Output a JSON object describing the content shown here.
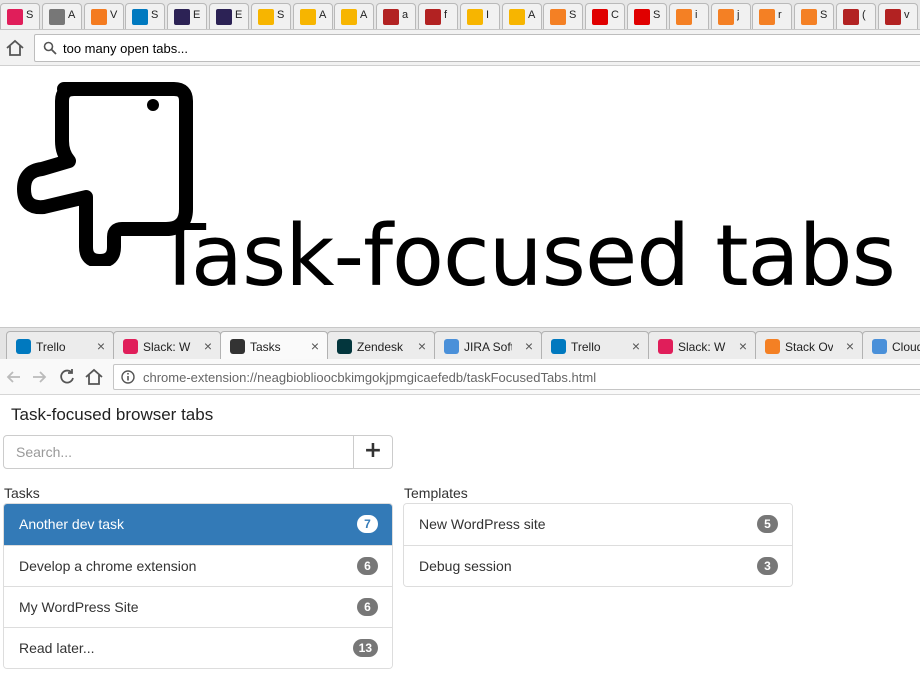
{
  "top_browser": {
    "tab_icons": [
      {
        "icon": "slack-icon",
        "color": "#e01e5a"
      },
      {
        "icon": "apple-icon",
        "color": "#777777"
      },
      {
        "icon": "gear-icon",
        "color": "#f47b20"
      },
      {
        "icon": "trello-icon",
        "color": "#0079bf"
      },
      {
        "icon": "eclipse-icon",
        "color": "#2c2255"
      },
      {
        "icon": "eclipse-icon",
        "color": "#2c2255"
      },
      {
        "icon": "aws-icon",
        "color": "#f7b500"
      },
      {
        "icon": "aws-icon",
        "color": "#f7b500"
      },
      {
        "icon": "aws-icon",
        "color": "#f7b500"
      },
      {
        "icon": "bars-icon",
        "color": "#b22222"
      },
      {
        "icon": "bars-icon",
        "color": "#b22222"
      },
      {
        "icon": "aws-icon",
        "color": "#f7b500"
      },
      {
        "icon": "xml-icon",
        "color": "#f7b500"
      },
      {
        "icon": "stackoverflow-icon",
        "color": "#f48024"
      },
      {
        "icon": "oracle-icon",
        "color": "#e00000"
      },
      {
        "icon": "oracle-icon",
        "color": "#e00000"
      },
      {
        "icon": "stackoverflow-icon",
        "color": "#f48024"
      },
      {
        "icon": "stackoverflow-icon",
        "color": "#f48024"
      },
      {
        "icon": "stackoverflow-icon",
        "color": "#f48024"
      },
      {
        "icon": "stackoverflow-icon",
        "color": "#f48024"
      },
      {
        "icon": "bars-icon",
        "color": "#b22222"
      },
      {
        "icon": "bars-icon",
        "color": "#b22222"
      }
    ],
    "tab_texts": [
      "S",
      "A",
      "V",
      "S",
      "E",
      "E",
      "S",
      "A",
      "A",
      "a",
      "f",
      "I",
      "A",
      "S",
      "C",
      "S",
      "i",
      "j",
      "r",
      "S",
      "(",
      "v"
    ],
    "omnibox_value": "too many open tabs..."
  },
  "hero": {
    "title": "Task-focused tabs"
  },
  "browser": {
    "tabs": [
      {
        "label": "Trello",
        "icon": "trello-icon",
        "color": "#0079bf",
        "active": false
      },
      {
        "label": "Slack: Wi",
        "icon": "slack-icon",
        "color": "#e01e5a",
        "active": false
      },
      {
        "label": "Tasks",
        "icon": "tasks-icon",
        "color": "#333333",
        "active": true
      },
      {
        "label": "Zendesk",
        "icon": "zendesk-icon",
        "color": "#03363d",
        "active": false
      },
      {
        "label": "JIRA Soft",
        "icon": "jira-icon",
        "color": "#4a90d9",
        "active": false
      },
      {
        "label": "Trello",
        "icon": "trello-icon",
        "color": "#0079bf",
        "active": false
      },
      {
        "label": "Slack: Wi",
        "icon": "slack-icon",
        "color": "#e01e5a",
        "active": false
      },
      {
        "label": "Stack Ov",
        "icon": "stackoverflow-icon",
        "color": "#f48024",
        "active": false
      },
      {
        "label": "Cloud",
        "icon": "cloud9-icon",
        "color": "#4a90d9",
        "active": false
      }
    ],
    "url": "chrome-extension://neagbioblioocbkimgokjpmgicaefedb/taskFocusedTabs.html"
  },
  "app": {
    "title": "Task-focused browser tabs",
    "search_placeholder": "Search...",
    "add_label": "+",
    "tasks_heading": "Tasks",
    "templates_heading": "Templates",
    "accent": "#337ab7",
    "tasks": [
      {
        "name": "Another dev task",
        "count": "7",
        "active": true
      },
      {
        "name": "Develop a chrome extension",
        "count": "6",
        "active": false
      },
      {
        "name": "My WordPress Site",
        "count": "6",
        "active": false
      },
      {
        "name": "Read later...",
        "count": "13",
        "active": false
      }
    ],
    "templates": [
      {
        "name": "New WordPress site",
        "count": "5"
      },
      {
        "name": "Debug session",
        "count": "3"
      }
    ]
  }
}
